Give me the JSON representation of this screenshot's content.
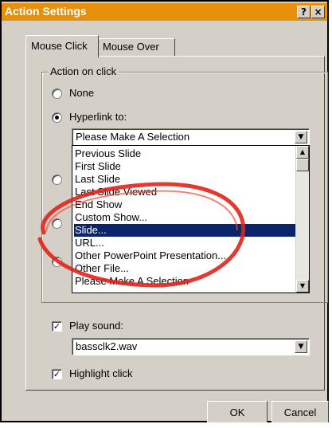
{
  "dialog": {
    "title": "Action Settings",
    "help_button": "?",
    "close_button": "×"
  },
  "tabs": [
    {
      "label": "Mouse Click",
      "active": true
    },
    {
      "label": "Mouse Over",
      "active": false
    }
  ],
  "action_group": {
    "label": "Action on click",
    "options": [
      {
        "label": "None",
        "checked": false
      },
      {
        "label": "Hyperlink to:",
        "checked": true
      }
    ]
  },
  "hyperlink": {
    "selected_value": "Please Make A Selection",
    "list": [
      "Previous Slide",
      "First Slide",
      "Last Slide",
      "Last Slide Viewed",
      "End Show",
      "Custom Show...",
      "Slide...",
      "URL...",
      "Other PowerPoint Presentation...",
      "Other File...",
      "Please Make A Selection"
    ],
    "highlighted_index": 6
  },
  "sound": {
    "label": "Play sound:",
    "checked": true,
    "value": "bassclk2.wav"
  },
  "highlight": {
    "label": "Highlight click",
    "checked": true
  },
  "buttons": {
    "ok": "OK",
    "cancel": "Cancel"
  },
  "colors": {
    "titlebar": "#e8900a",
    "selection": "#0a246a",
    "annotation": "#e0241a"
  }
}
